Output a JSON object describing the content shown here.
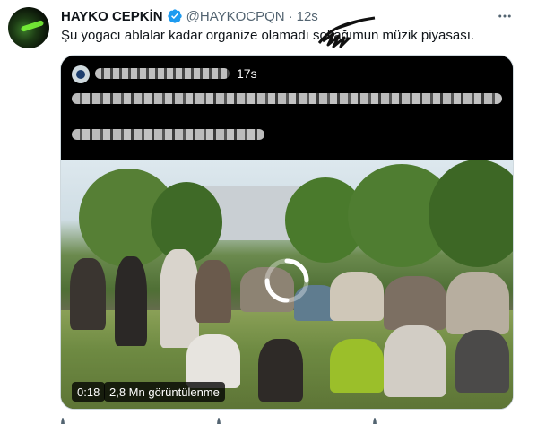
{
  "tweet": {
    "author_name": "HAYKO CEPKİN",
    "handle": "@HAYKOCPQN",
    "separator": "·",
    "time": "12s",
    "text": "Şu yogacı ablalar kadar organize olamadı sokağımun müzik piyasası.",
    "more_icon": "ellipsis-icon"
  },
  "quoted": {
    "time": "17s",
    "video": {
      "duration": "0:18",
      "views": "2,8 Mn görüntülenme"
    }
  },
  "colors": {
    "text_primary": "#0f1419",
    "text_secondary": "#536471",
    "verified_blue": "#1d9bf0",
    "border": "#cfd9de"
  }
}
